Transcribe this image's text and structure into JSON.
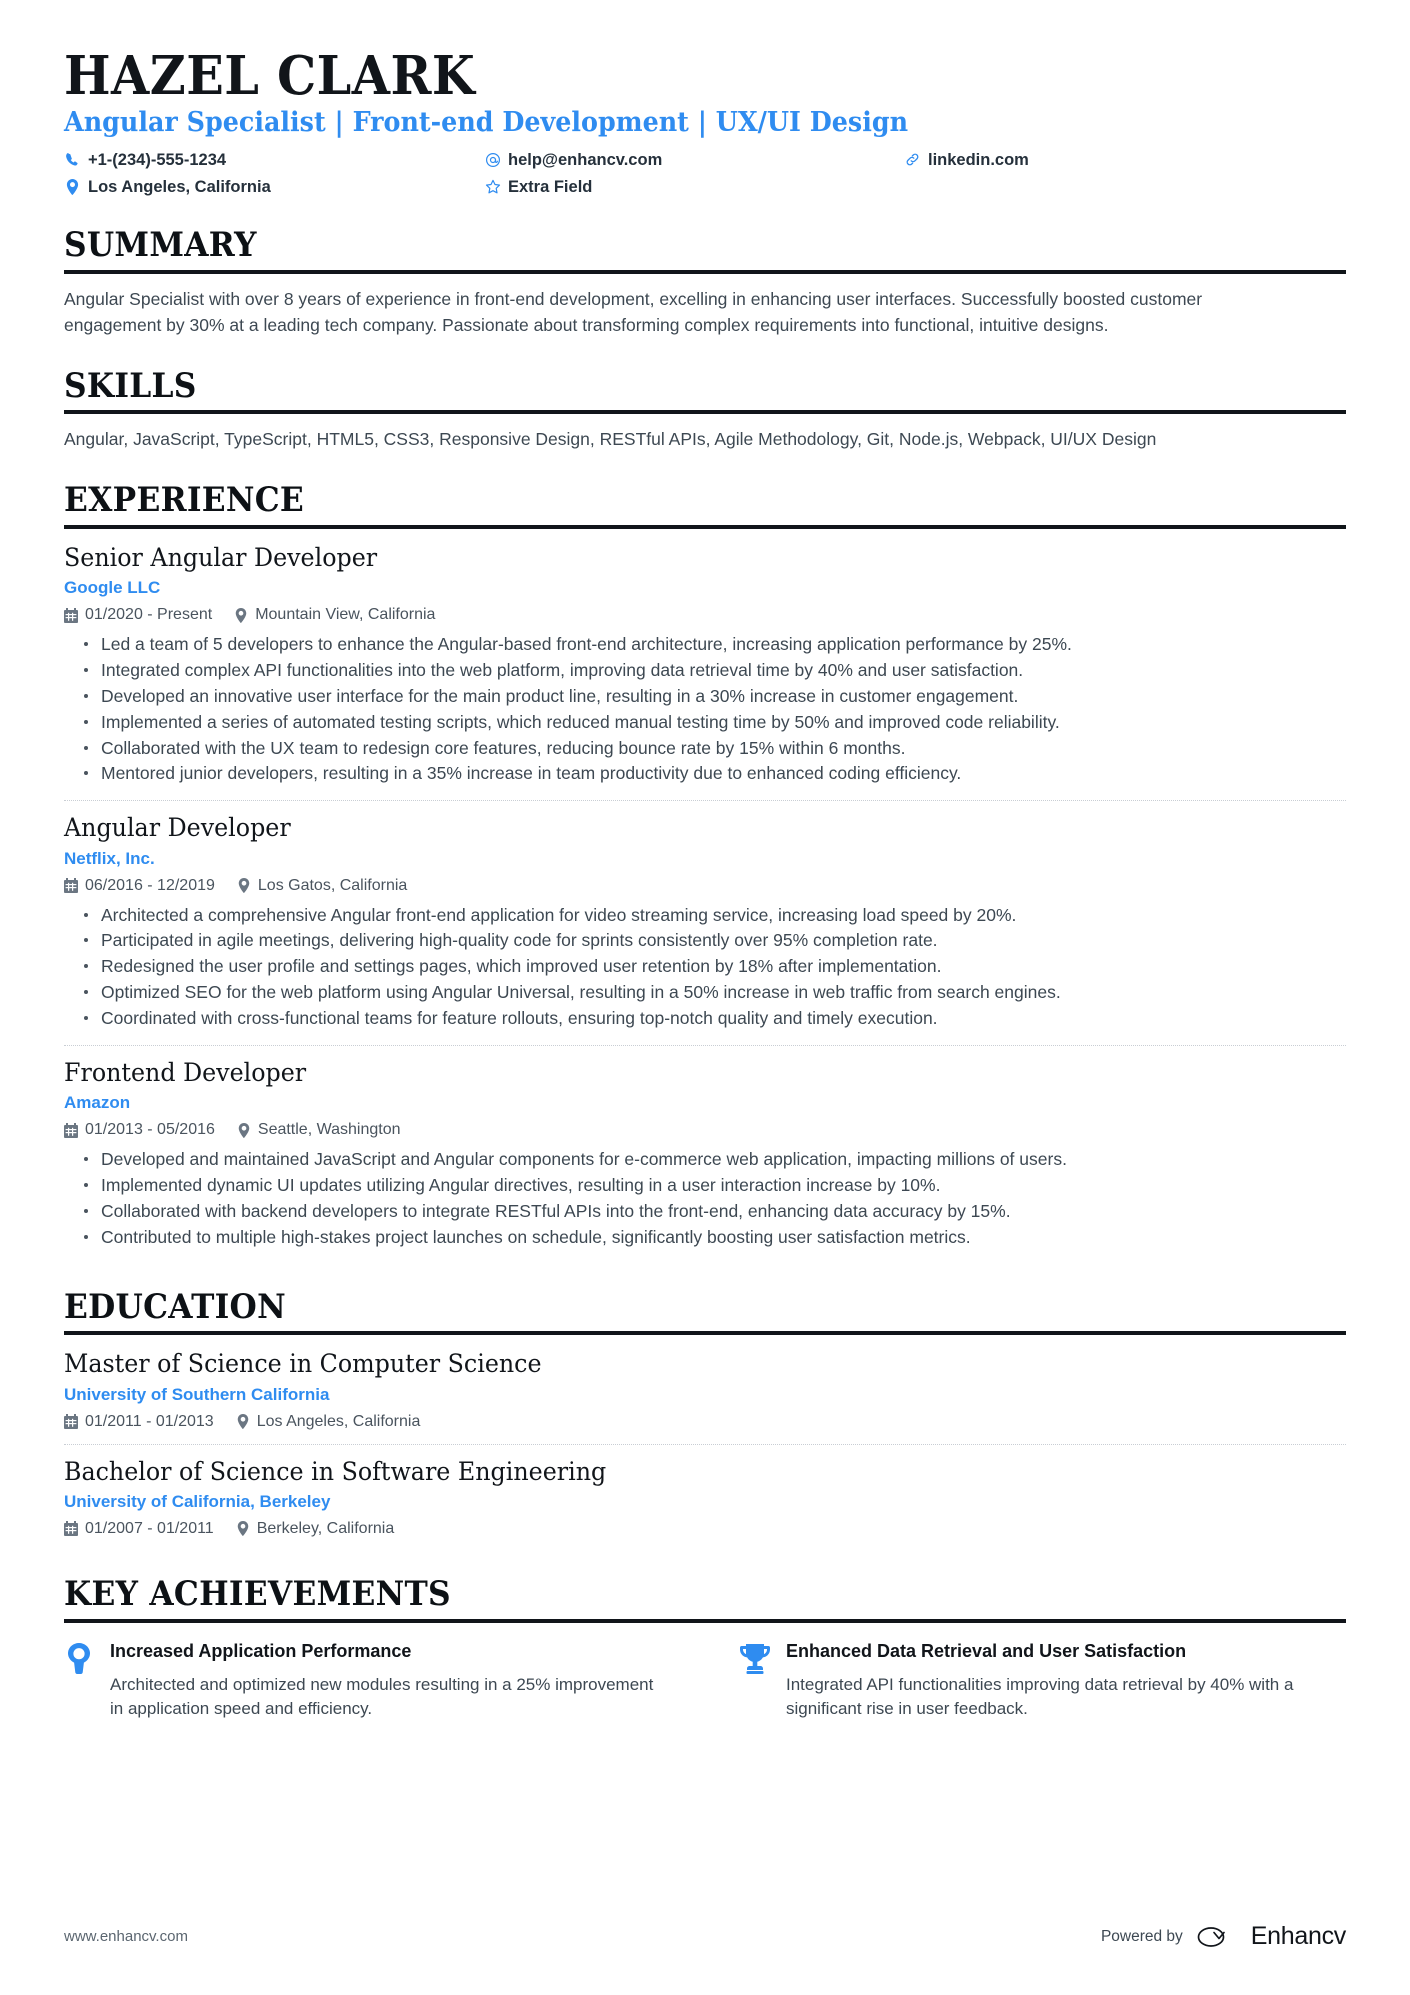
{
  "header": {
    "name": "HAZEL CLARK",
    "headline": "Angular Specialist | Front-end Development | UX/UI Design",
    "contacts": [
      {
        "icon": "phone-icon",
        "text": "+1-(234)-555-1234"
      },
      {
        "icon": "email-icon",
        "text": "help@enhancv.com"
      },
      {
        "icon": "link-icon",
        "text": "linkedin.com"
      },
      {
        "icon": "location-pin-icon",
        "text": "Los Angeles, California"
      },
      {
        "icon": "star-icon",
        "text": "Extra Field"
      }
    ]
  },
  "summary": {
    "title": "SUMMARY",
    "text": "Angular Specialist with over 8 years of experience in front-end development, excelling in enhancing user interfaces. Successfully boosted customer engagement by 30% at a leading tech company. Passionate about transforming complex requirements into functional, intuitive designs."
  },
  "skills": {
    "title": "SKILLS",
    "text": "Angular, JavaScript, TypeScript, HTML5, CSS3, Responsive Design, RESTful APIs, Agile Methodology, Git, Node.js, Webpack, UI/UX Design"
  },
  "experience": {
    "title": "EXPERIENCE",
    "entries": [
      {
        "role": "Senior Angular Developer",
        "company": "Google LLC",
        "dates": "01/2020 - Present",
        "location": "Mountain View, California",
        "bullets": [
          "Led a team of 5 developers to enhance the Angular-based front-end architecture, increasing application performance by 25%.",
          "Integrated complex API functionalities into the web platform, improving data retrieval time by 40% and user satisfaction.",
          "Developed an innovative user interface for the main product line, resulting in a 30% increase in customer engagement.",
          "Implemented a series of automated testing scripts, which reduced manual testing time by 50% and improved code reliability.",
          "Collaborated with the UX team to redesign core features, reducing bounce rate by 15% within 6 months.",
          "Mentored junior developers, resulting in a 35% increase in team productivity due to enhanced coding efficiency."
        ]
      },
      {
        "role": "Angular Developer",
        "company": "Netflix, Inc.",
        "dates": "06/2016 - 12/2019",
        "location": "Los Gatos, California",
        "bullets": [
          "Architected a comprehensive Angular front-end application for video streaming service, increasing load speed by 20%.",
          "Participated in agile meetings, delivering high-quality code for sprints consistently over 95% completion rate.",
          "Redesigned the user profile and settings pages, which improved user retention by 18% after implementation.",
          "Optimized SEO for the web platform using Angular Universal, resulting in a 50% increase in web traffic from search engines.",
          "Coordinated with cross-functional teams for feature rollouts, ensuring top-notch quality and timely execution."
        ]
      },
      {
        "role": "Frontend Developer",
        "company": "Amazon",
        "dates": "01/2013 - 05/2016",
        "location": "Seattle, Washington",
        "bullets": [
          "Developed and maintained JavaScript and Angular components for e-commerce web application, impacting millions of users.",
          "Implemented dynamic UI updates utilizing Angular directives, resulting in a user interaction increase by 10%.",
          "Collaborated with backend developers to integrate RESTful APIs into the front-end, enhancing data accuracy by 15%.",
          "Contributed to multiple high-stakes project launches on schedule, significantly boosting user satisfaction metrics."
        ]
      }
    ]
  },
  "education": {
    "title": "EDUCATION",
    "entries": [
      {
        "degree": "Master of Science in Computer Science",
        "school": "University of Southern California",
        "dates": "01/2011 - 01/2013",
        "location": "Los Angeles, California"
      },
      {
        "degree": "Bachelor of Science in Software Engineering",
        "school": "University of California, Berkeley",
        "dates": "01/2007 - 01/2011",
        "location": "Berkeley, California"
      }
    ]
  },
  "achievements": {
    "title": "KEY ACHIEVEMENTS",
    "items": [
      {
        "icon": "lightbulb-pin-icon",
        "title": "Increased Application Performance",
        "desc": "Architected and optimized new modules resulting in a 25% improvement in application speed and efficiency."
      },
      {
        "icon": "trophy-icon",
        "title": "Enhanced Data Retrieval and User Satisfaction",
        "desc": "Integrated API functionalities improving data retrieval by 40% with a significant rise in user feedback."
      }
    ]
  },
  "footer": {
    "url": "www.enhancv.com",
    "powered_by": "Powered by",
    "brand": "Enhancv"
  },
  "colors": {
    "accent": "#2f8cf0",
    "text": "#3d4852",
    "heading": "#11151a"
  }
}
